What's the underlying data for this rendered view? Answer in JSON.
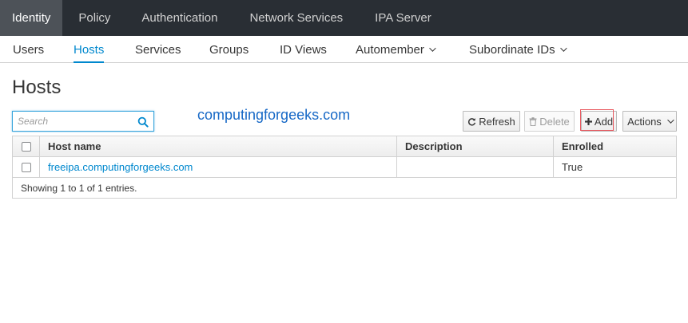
{
  "topnav": {
    "tabs": [
      "Identity",
      "Policy",
      "Authentication",
      "Network Services",
      "IPA Server"
    ],
    "active": "Identity"
  },
  "subnav": {
    "items": [
      "Users",
      "Hosts",
      "Services",
      "Groups",
      "ID Views",
      "Automember",
      "Subordinate IDs"
    ],
    "active": "Hosts"
  },
  "page": {
    "title": "Hosts",
    "watermark": "computingforgeeks.com"
  },
  "search": {
    "placeholder": "Search",
    "value": ""
  },
  "toolbar": {
    "refresh_label": "Refresh",
    "delete_label": "Delete",
    "add_label": "Add",
    "actions_label": "Actions"
  },
  "table": {
    "columns": [
      "Host name",
      "Description",
      "Enrolled"
    ],
    "rows": [
      {
        "host_name": "freeipa.computingforgeeks.com",
        "description": "",
        "enrolled": "True"
      }
    ],
    "footer": "Showing 1 to 1 of 1 entries."
  },
  "icons": {
    "search": "search-icon",
    "refresh": "refresh-icon",
    "delete": "trash-icon",
    "add": "plus-icon",
    "actions": "chevron-down-icon"
  },
  "colors": {
    "accent": "#0088ce",
    "topnav_bg": "#292e34",
    "highlight_box": "#e8585f",
    "watermark": "#1668c6"
  }
}
